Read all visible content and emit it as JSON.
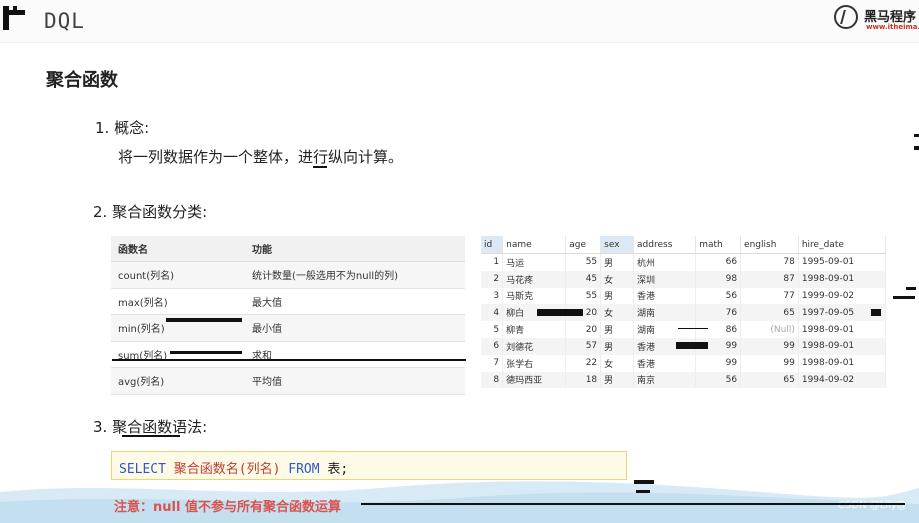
{
  "header": {
    "title": "DQL",
    "brand_name": "黑马程序",
    "brand_url": "www.itheima.c"
  },
  "section_title": "聚合函数",
  "items": {
    "item1_title": "1. 概念:",
    "item1_desc": "将一列数据作为一个整体，进行纵向计算。",
    "item2_title": "2. 聚合函数分类:",
    "item3_title": "3. 聚合函数语法:"
  },
  "function_table": {
    "headers": [
      "函数名",
      "功能"
    ],
    "rows": [
      [
        "count(列名)",
        "统计数量(一般选用不为null的列)"
      ],
      [
        "max(列名)",
        "最大值"
      ],
      [
        "min(列名)",
        "最小值"
      ],
      [
        "sum(列名)",
        "求和"
      ],
      [
        "avg(列名)",
        "平均值"
      ]
    ]
  },
  "data_table": {
    "headers": [
      "id",
      "name",
      "age",
      "sex",
      "address",
      "math",
      "english",
      "hire_date"
    ],
    "rows": [
      [
        "1",
        "马运",
        "55",
        "男",
        "杭州",
        "66",
        "78",
        "1995-09-01"
      ],
      [
        "2",
        "马花疼",
        "45",
        "女",
        "深圳",
        "98",
        "87",
        "1998-09-01"
      ],
      [
        "3",
        "马斯克",
        "55",
        "男",
        "香港",
        "56",
        "77",
        "1999-09-02"
      ],
      [
        "4",
        "柳白",
        "20",
        "女",
        "湖南",
        "76",
        "65",
        "1997-09-05"
      ],
      [
        "5",
        "柳青",
        "20",
        "男",
        "湖南",
        "86",
        "(Null)",
        "1998-09-01"
      ],
      [
        "6",
        "刘德花",
        "57",
        "男",
        "香港",
        "99",
        "99",
        "1998-09-01"
      ],
      [
        "7",
        "张学右",
        "22",
        "女",
        "香港",
        "99",
        "99",
        "1998-09-01"
      ],
      [
        "8",
        "德玛西亚",
        "18",
        "男",
        "南京",
        "56",
        "65",
        "1994-09-02"
      ]
    ]
  },
  "code": {
    "kw_select": "SELECT",
    "func": "聚合函数名(列名)",
    "kw_from": "FROM",
    "table": "表;"
  },
  "note": "注意：null 值不参与所有聚合函数运算",
  "watermark": "CSDN @Lily@"
}
